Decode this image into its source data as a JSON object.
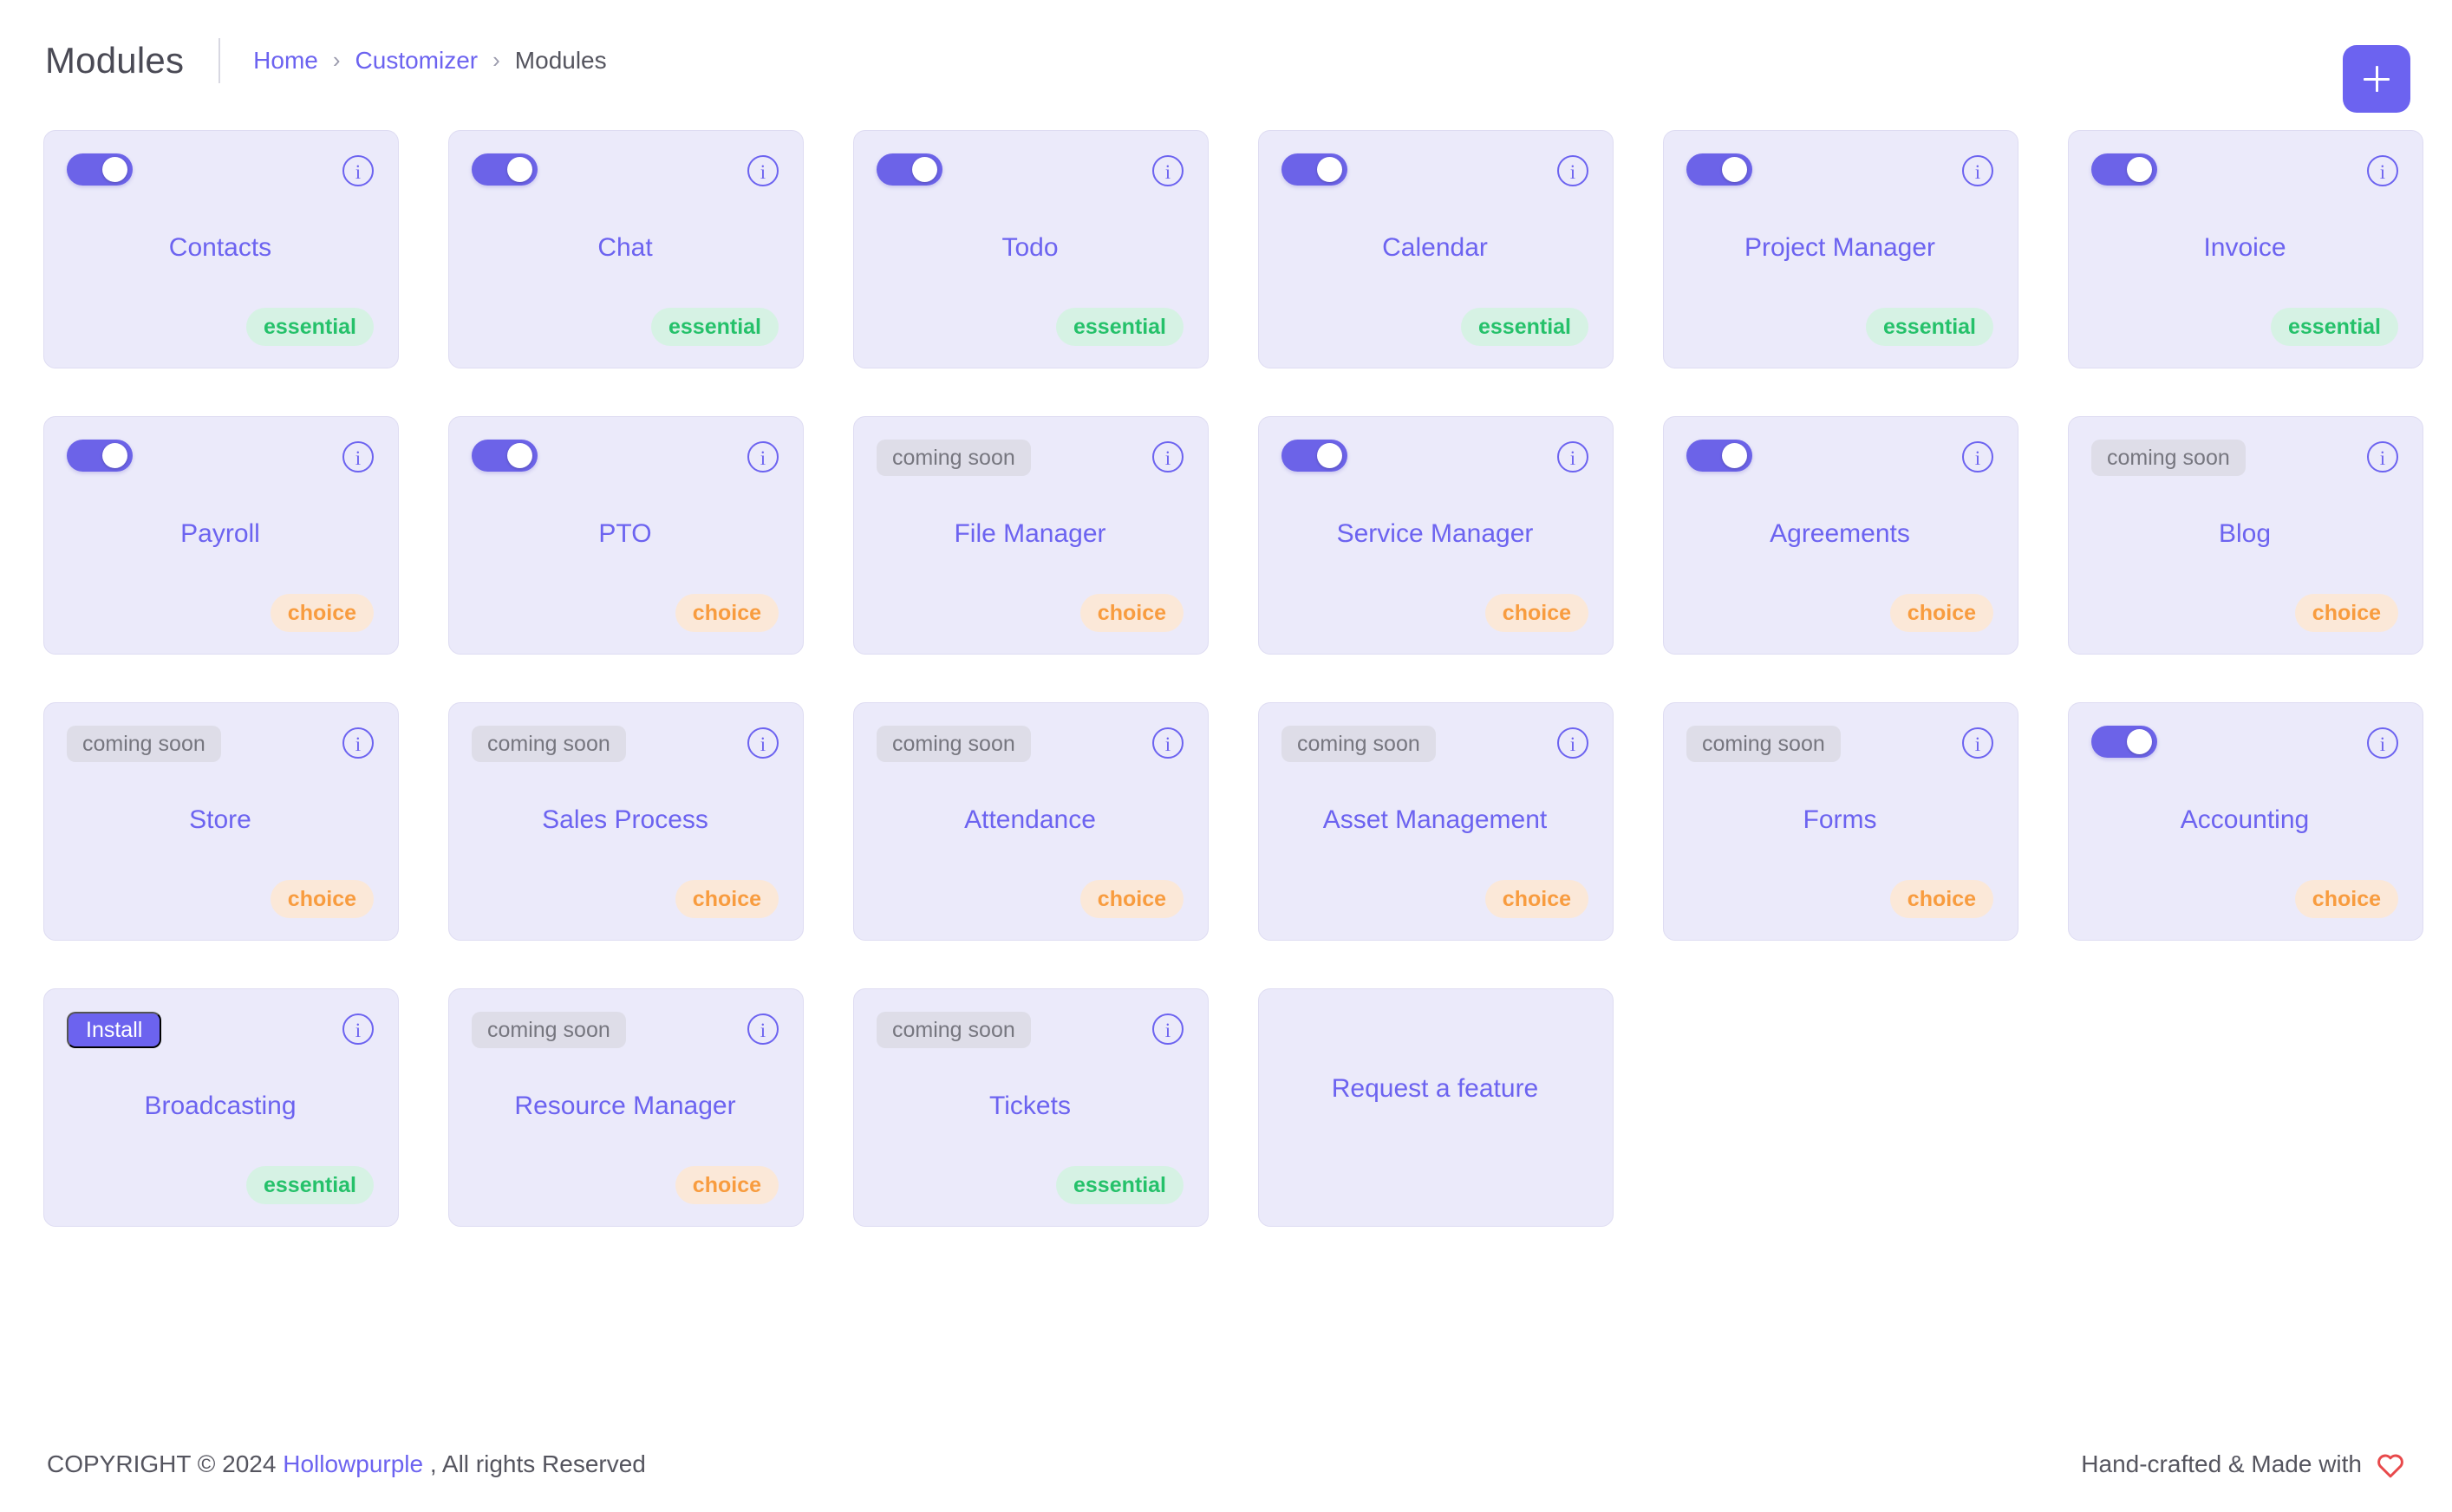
{
  "header": {
    "title": "Modules",
    "breadcrumb": [
      {
        "label": "Home",
        "type": "link"
      },
      {
        "label": "Customizer",
        "type": "link"
      },
      {
        "label": "Modules",
        "type": "current"
      }
    ],
    "separator": "›",
    "add_button_icon": "plus-icon"
  },
  "colors": {
    "accent": "#6c63f0",
    "card_bg": "#ebeafa",
    "essential_bg": "#d6f2e4",
    "essential_text": "#25c16a",
    "choice_bg": "#fbe8d8",
    "choice_text": "#f89c3f",
    "coming_soon_bg": "#dedde8",
    "coming_soon_text": "#76767f",
    "heart": "#e8494b"
  },
  "labels": {
    "coming_soon": "coming soon",
    "install": "Install",
    "essential": "essential",
    "choice": "choice",
    "info": "i"
  },
  "modules": [
    {
      "name": "Contacts",
      "control": "toggle",
      "toggle_on": true,
      "tag": "essential"
    },
    {
      "name": "Chat",
      "control": "toggle",
      "toggle_on": true,
      "tag": "essential"
    },
    {
      "name": "Todo",
      "control": "toggle",
      "toggle_on": true,
      "tag": "essential"
    },
    {
      "name": "Calendar",
      "control": "toggle",
      "toggle_on": true,
      "tag": "essential"
    },
    {
      "name": "Project Manager",
      "control": "toggle",
      "toggle_on": true,
      "tag": "essential"
    },
    {
      "name": "Invoice",
      "control": "toggle",
      "toggle_on": true,
      "tag": "essential"
    },
    {
      "name": "Payroll",
      "control": "toggle",
      "toggle_on": true,
      "tag": "choice"
    },
    {
      "name": "PTO",
      "control": "toggle",
      "toggle_on": true,
      "tag": "choice"
    },
    {
      "name": "File Manager",
      "control": "coming-soon",
      "toggle_on": false,
      "tag": "choice"
    },
    {
      "name": "Service Manager",
      "control": "toggle",
      "toggle_on": true,
      "tag": "choice"
    },
    {
      "name": "Agreements",
      "control": "toggle",
      "toggle_on": true,
      "tag": "choice"
    },
    {
      "name": "Blog",
      "control": "coming-soon",
      "toggle_on": false,
      "tag": "choice"
    },
    {
      "name": "Store",
      "control": "coming-soon",
      "toggle_on": false,
      "tag": "choice"
    },
    {
      "name": "Sales Process",
      "control": "coming-soon",
      "toggle_on": false,
      "tag": "choice"
    },
    {
      "name": "Attendance",
      "control": "coming-soon",
      "toggle_on": false,
      "tag": "choice"
    },
    {
      "name": "Asset Management",
      "control": "coming-soon",
      "toggle_on": false,
      "tag": "choice"
    },
    {
      "name": "Forms",
      "control": "coming-soon",
      "toggle_on": false,
      "tag": "choice"
    },
    {
      "name": "Accounting",
      "control": "toggle",
      "toggle_on": true,
      "tag": "choice"
    },
    {
      "name": "Broadcasting",
      "control": "install",
      "toggle_on": false,
      "tag": "essential"
    },
    {
      "name": "Resource Manager",
      "control": "coming-soon",
      "toggle_on": false,
      "tag": "choice"
    },
    {
      "name": "Tickets",
      "control": "coming-soon",
      "toggle_on": false,
      "tag": "essential"
    },
    {
      "name": "Request a feature",
      "control": "none",
      "toggle_on": false,
      "tag": "none"
    }
  ],
  "footer": {
    "copyright_prefix": "COPYRIGHT © 2024",
    "brand": "Hollowpurple",
    "copyright_suffix": ", All rights Reserved",
    "made_with": "Hand-crafted & Made with",
    "heart_icon": "heart-icon"
  }
}
